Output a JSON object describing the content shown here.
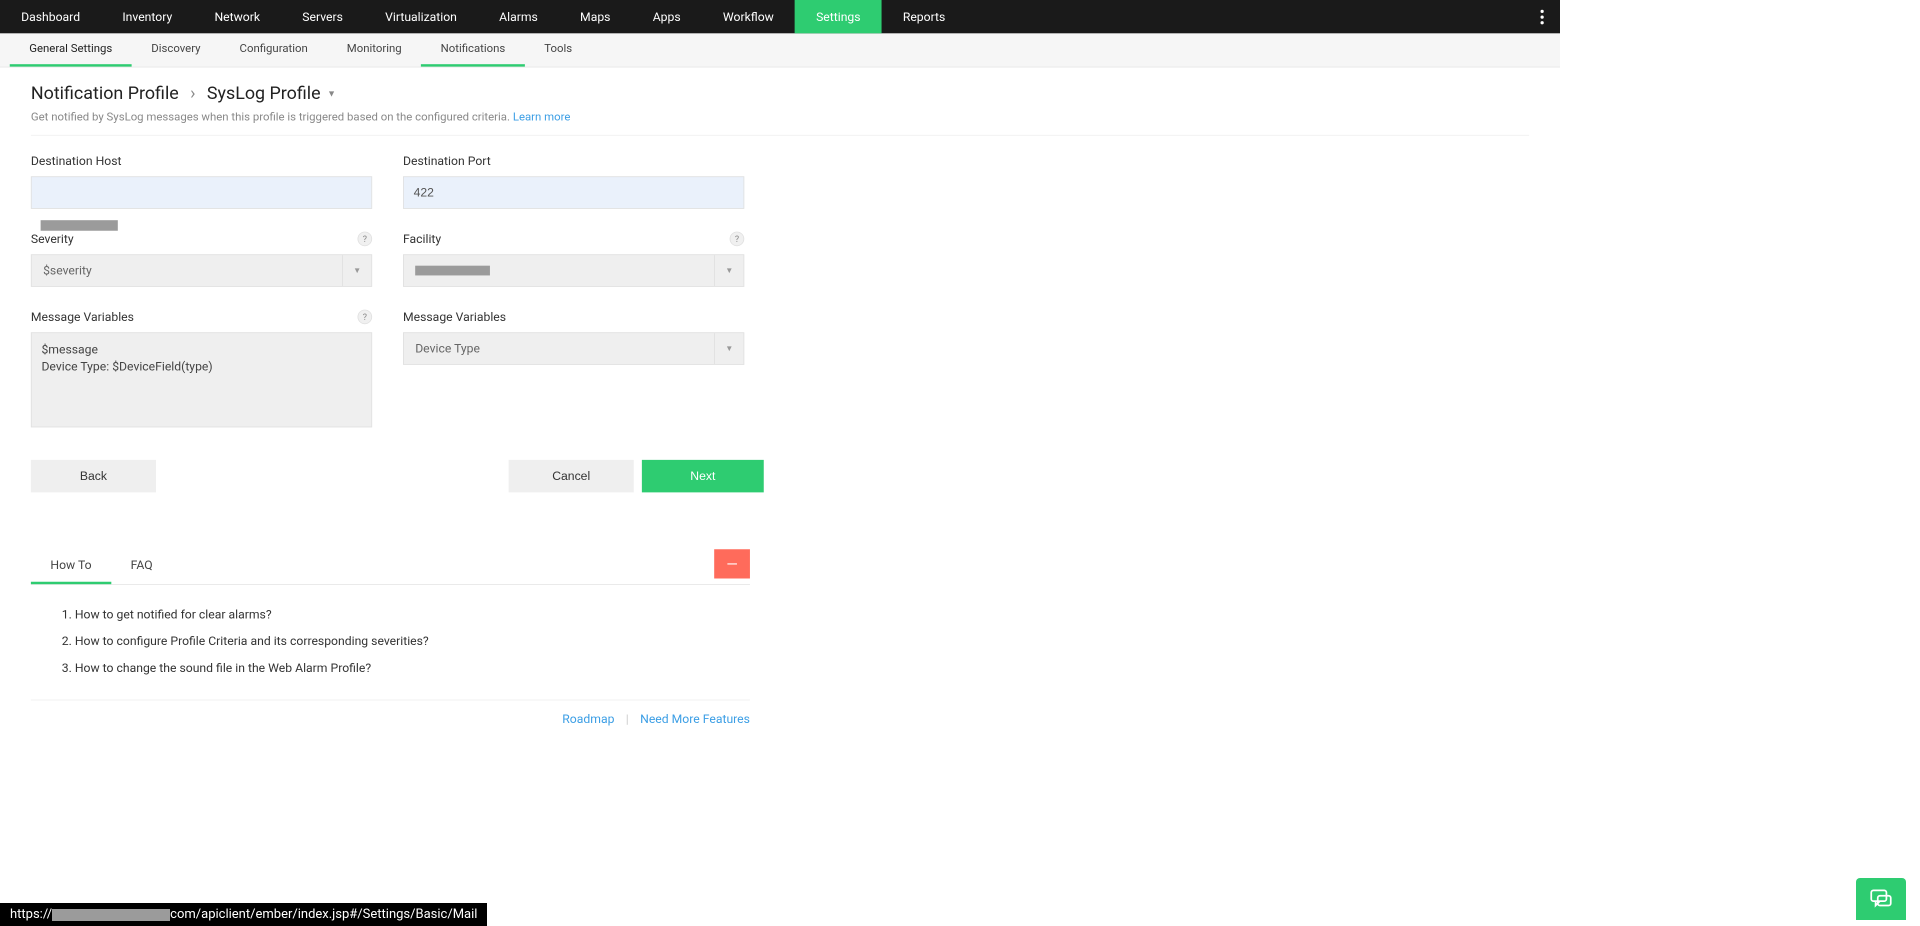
{
  "topnav": {
    "items": [
      "Dashboard",
      "Inventory",
      "Network",
      "Servers",
      "Virtualization",
      "Alarms",
      "Maps",
      "Apps",
      "Workflow",
      "Settings",
      "Reports"
    ],
    "active": "Settings"
  },
  "subnav": {
    "items": [
      "General Settings",
      "Discovery",
      "Configuration",
      "Monitoring",
      "Notifications",
      "Tools"
    ],
    "primary": "General Settings",
    "secondary": "Notifications"
  },
  "breadcrumb": {
    "parent": "Notification Profile",
    "current": "SysLog Profile"
  },
  "subtitle": {
    "text": "Get notified by SysLog messages when this profile is triggered based on the configured criteria.",
    "link": "Learn more"
  },
  "form": {
    "dest_host_label": "Destination Host",
    "dest_host_value": "",
    "dest_port_label": "Destination Port",
    "dest_port_value": "422",
    "severity_label": "Severity",
    "severity_value": "$severity",
    "facility_label": "Facility",
    "facility_value": "",
    "msgvar_left_label": "Message Variables",
    "msgvar_left_value": "$message\nDevice Type: $DeviceField(type)",
    "msgvar_right_label": "Message Variables",
    "msgvar_right_value": "Device Type"
  },
  "buttons": {
    "back": "Back",
    "cancel": "Cancel",
    "next": "Next"
  },
  "help": {
    "tabs": [
      "How To",
      "FAQ"
    ],
    "active": "How To",
    "items": [
      "How to get notified for clear alarms?",
      "How to configure Profile Criteria and its corresponding severities?",
      "How to change the sound file in the Web Alarm Profile?"
    ],
    "footer": {
      "roadmap": "Roadmap",
      "need": "Need More Features"
    }
  },
  "status": {
    "prefix": "https://",
    "suffix": "com/apiclient/ember/index.jsp#/Settings/Basic/Mail"
  }
}
